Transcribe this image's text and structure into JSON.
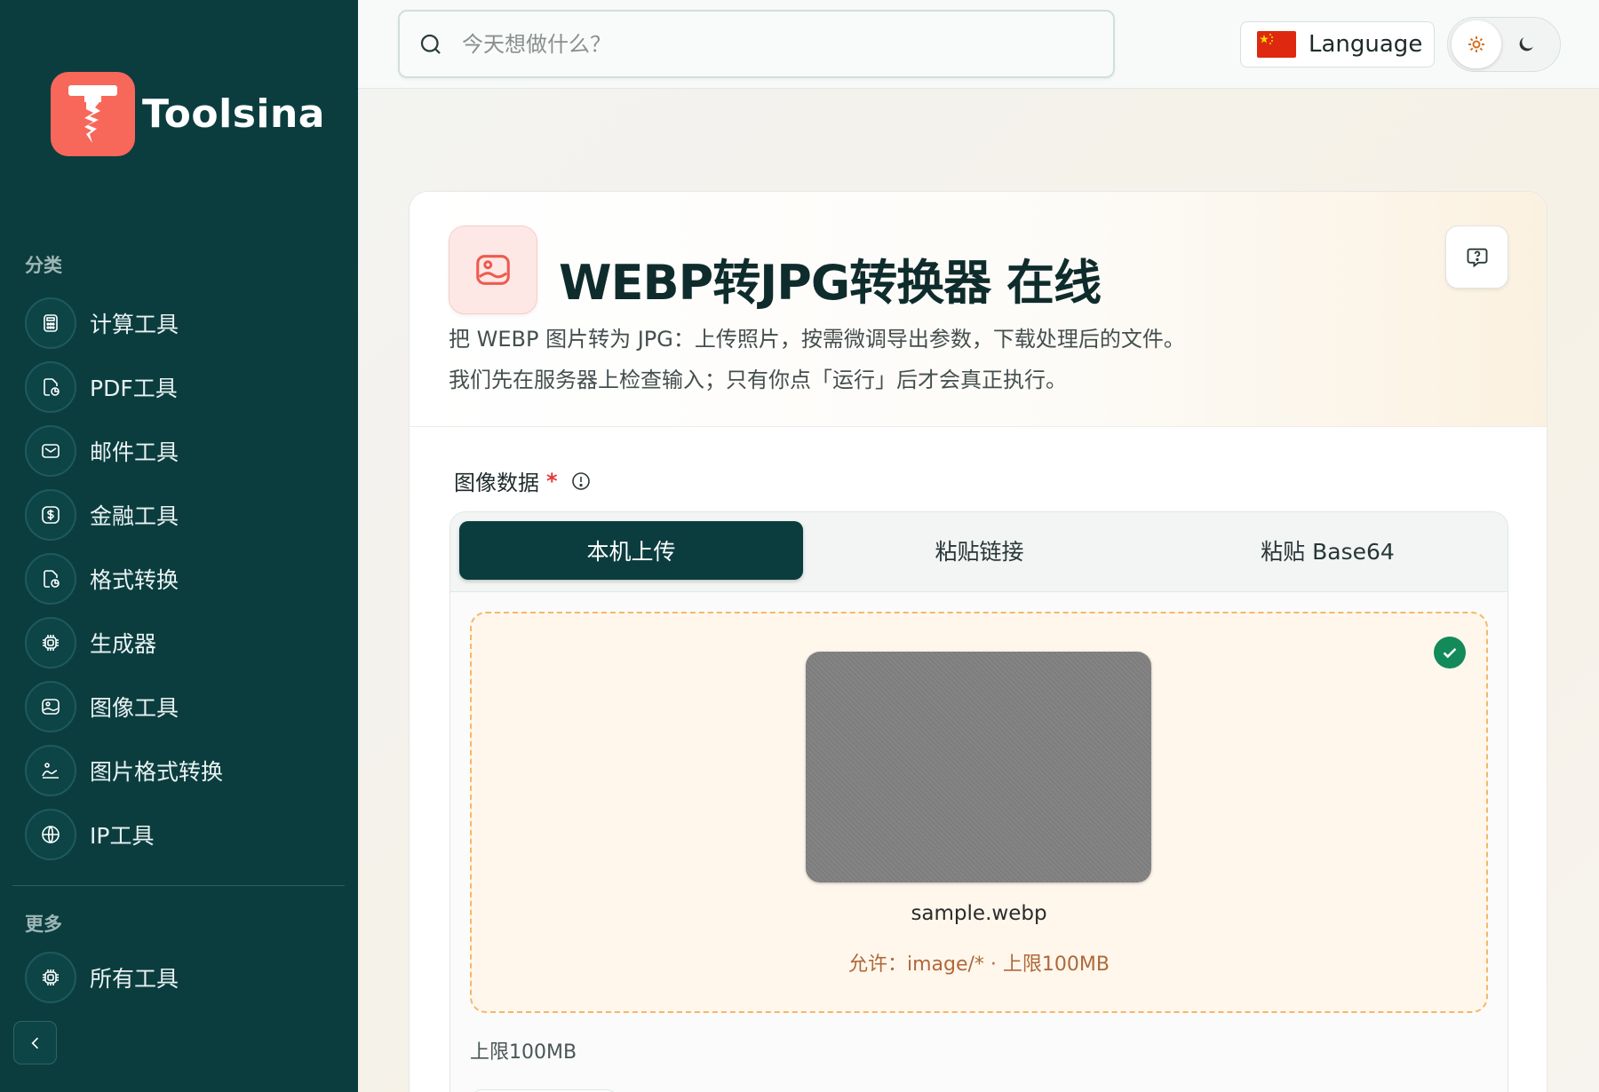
{
  "brand": {
    "name": "Toolsina"
  },
  "sidebar": {
    "section_categories": "分类",
    "items": [
      {
        "label": "计算工具",
        "icon": "calculator-icon"
      },
      {
        "label": "PDF工具",
        "icon": "file-pie-icon"
      },
      {
        "label": "邮件工具",
        "icon": "mail-icon"
      },
      {
        "label": "金融工具",
        "icon": "dollar-icon"
      },
      {
        "label": "格式转换",
        "icon": "file-pie-icon"
      },
      {
        "label": "生成器",
        "icon": "cpu-icon"
      },
      {
        "label": "图像工具",
        "icon": "image-icon"
      },
      {
        "label": "图片格式转换",
        "icon": "image-convert-icon"
      },
      {
        "label": "IP工具",
        "icon": "globe-icon"
      }
    ],
    "section_more": "更多",
    "more_items": [
      {
        "label": "所有工具",
        "icon": "cpu-icon"
      }
    ]
  },
  "topbar": {
    "search_placeholder": "今天想做什么？",
    "language_label": "Language"
  },
  "tool": {
    "title": "WEBP转JPG转换器 在线",
    "desc_line1": "把 WEBP 图片转为 JPG：上传照片，按需微调导出参数，下载处理后的文件。",
    "desc_line2": "我们先在服务器上检查输入；只有你点「运行」后才会真正执行。",
    "field_label": "图像数据",
    "required_mark": "*",
    "tabs": [
      "本机上传",
      "粘贴链接",
      "粘贴 Base64"
    ],
    "file_name": "sample.webp",
    "allow_text": "允许：image/* · 上限100MB",
    "limit_text": "上限100MB"
  },
  "colors": {
    "sidebar_bg": "#0b3d3f",
    "brand_accent": "#f7675a",
    "dropzone_border": "#f5b76a",
    "success": "#128a5a"
  }
}
